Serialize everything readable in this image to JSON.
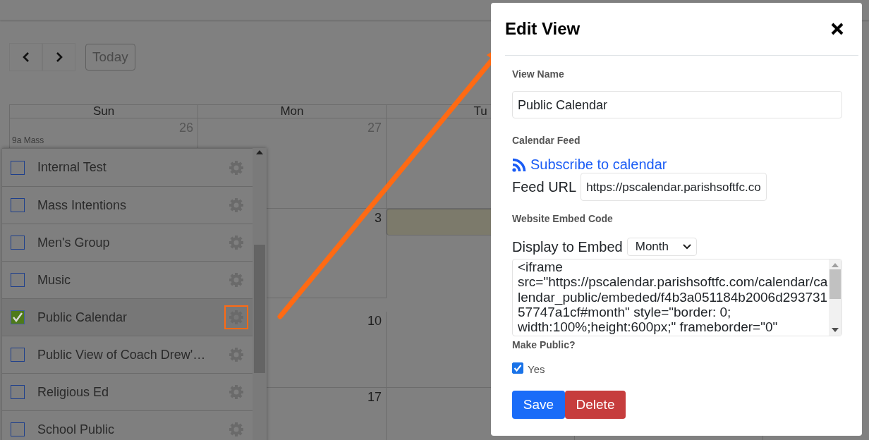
{
  "toolbar": {
    "today_button": "Today"
  },
  "calendar": {
    "weekdays": [
      "Sun",
      "Mon",
      "Tu"
    ],
    "weeks": [
      {
        "cells": [
          {
            "date": "26",
            "events": [
              "9a Mass"
            ]
          },
          {
            "date": "27"
          },
          {}
        ]
      },
      {
        "cells": [
          {},
          {
            "date": "3"
          },
          {
            "today": true
          }
        ]
      },
      {
        "cells": [
          {},
          {
            "date": "10"
          },
          {}
        ]
      },
      {
        "cells": [
          {},
          {
            "date": "17"
          },
          {}
        ]
      }
    ]
  },
  "calendar_list": {
    "items": [
      {
        "label": "Internal Test",
        "checked": false,
        "selected": false
      },
      {
        "label": "Mass Intentions",
        "checked": false,
        "selected": false
      },
      {
        "label": "Men's Group",
        "checked": false,
        "selected": false
      },
      {
        "label": "Music",
        "checked": false,
        "selected": false
      },
      {
        "label": "Public Calendar",
        "checked": true,
        "selected": true
      },
      {
        "label": "Public View of Coach Drew'…",
        "checked": false,
        "selected": false
      },
      {
        "label": "Religious Ed",
        "checked": false,
        "selected": false
      },
      {
        "label": "School Public",
        "checked": false,
        "selected": false
      }
    ]
  },
  "modal": {
    "title": "Edit View",
    "view_name": {
      "label": "View Name",
      "value": "Public Calendar"
    },
    "calendar_feed": {
      "label": "Calendar Feed",
      "subscribe_link": "Subscribe to calendar",
      "feed_url_label": "Feed URL",
      "feed_url": "https://pscalendar.parishsoftfc.co"
    },
    "embed": {
      "label": "Website Embed Code",
      "display_label": "Display to Embed",
      "display_value": "Month",
      "code": "<iframe src=\"https://pscalendar.parishsoftfc.com/calendar/calendar_public/embeded/f4b3a051184b2006d29373157747a1cf#month\" style=\"border: 0; width:100%;height:600px;\" frameborder=\"0\""
    },
    "make_public": {
      "label": "Make Public?",
      "option": "Yes",
      "checked": true
    },
    "buttons": {
      "save": "Save",
      "delete": "Delete"
    }
  }
}
